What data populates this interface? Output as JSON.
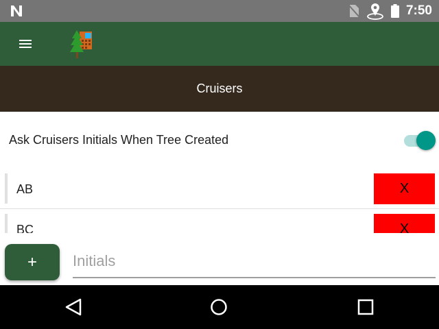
{
  "status_bar": {
    "time": "7:50",
    "icons": [
      "n-notification-icon",
      "no-sim-icon",
      "location-icon",
      "battery-icon"
    ]
  },
  "toolbar": {
    "menu_icon": "hamburger-menu-icon",
    "logo_icon": "tree-building-logo-icon"
  },
  "page": {
    "title": "Cruisers"
  },
  "settings": {
    "ask_initials_label": "Ask Cruisers Initials When Tree Created",
    "ask_initials_enabled": true
  },
  "cruisers": [
    {
      "initials": "AB",
      "delete_label": "X"
    },
    {
      "initials": "BC",
      "delete_label": "X"
    }
  ],
  "add_cruiser": {
    "button_label": "+",
    "input_placeholder": "Initials",
    "input_value": ""
  },
  "colors": {
    "toolbar": "#2f5d3a",
    "title_bar": "#35281c",
    "delete_button": "#ff0000",
    "toggle_accent": "#009688"
  },
  "nav_bar": {
    "icons": [
      "back-icon",
      "home-icon",
      "recents-icon"
    ]
  }
}
